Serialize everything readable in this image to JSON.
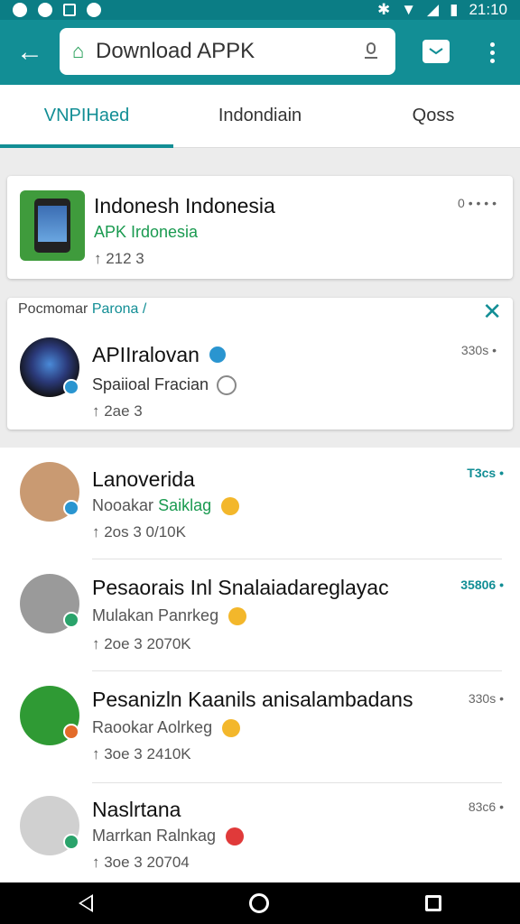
{
  "statusbar": {
    "time": "21:10"
  },
  "appbar": {
    "search_value": "Download APPK"
  },
  "tabs": [
    {
      "label": "VNPIHaed",
      "active": true
    },
    {
      "label": "Indondiain",
      "active": false
    },
    {
      "label": "Qoss",
      "active": false
    }
  ],
  "featured": {
    "title": "Indonesh Indonesia",
    "subtitle": "APK Irdonesia",
    "meta": "↑ 212 3",
    "time": "0 • • • •"
  },
  "promo": {
    "label_prefix": "Pocmomar",
    "label_highlight": "Parona",
    "label_suffix": "/",
    "title": "APIIralovan",
    "subtitle": "Spaiioal Fracian",
    "meta": "↑ 2ae 3",
    "time": "330s •"
  },
  "list": [
    {
      "name": "Lanoverida",
      "sub_prefix": "Nooakar",
      "sub_green": "Saiklag",
      "meta": "↑ 2os 3 0/10K",
      "time": "T3cs •",
      "time_green": true,
      "avatar_color": "#c99a72",
      "badge_color": "#2a95d0"
    },
    {
      "name": "Pesaorais Inl Snalaiadareglayac",
      "sub_prefix": "Mulakan Panrkeg",
      "sub_green": "",
      "meta": "↑ 2oe 3 2070K",
      "time": "35806 •",
      "time_green": true,
      "avatar_color": "#9a9a9a",
      "badge_color": "#2aa36b"
    },
    {
      "name": "Pesanizln Kaanils anisalambadans",
      "sub_prefix": "Raookar Aolrkeg",
      "sub_green": "",
      "meta": "↑ 3oe 3 2410K",
      "time": "330s •",
      "time_green": false,
      "avatar_color": "#2f9a34",
      "badge_color": "#e36b2a"
    },
    {
      "name": "Naslrtana",
      "sub_prefix": "Marrkan Ralnkag",
      "sub_green": "",
      "meta": "↑ 3oe 3 20704",
      "time": "83c6 •",
      "time_green": false,
      "avatar_color": "#d0d0d0",
      "badge_color": "#2aa36b"
    }
  ]
}
